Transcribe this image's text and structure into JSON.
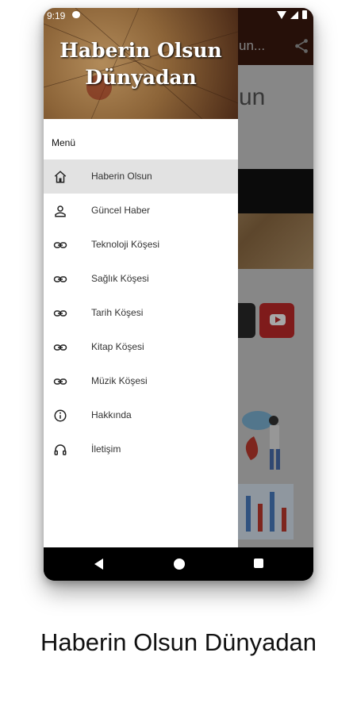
{
  "status_bar": {
    "time": "9:19"
  },
  "background_app": {
    "title": "un...",
    "heading": "un"
  },
  "drawer": {
    "header_title_line1": "Haberin Olsun",
    "header_title_line2": "Dünyadan",
    "menu_label": "Menü",
    "items": [
      {
        "label": "Haberin Olsun",
        "icon": "home-icon",
        "active": true
      },
      {
        "label": "Güncel Haber",
        "icon": "person-icon",
        "active": false
      },
      {
        "label": "Teknoloji Köşesi",
        "icon": "link-icon",
        "active": false
      },
      {
        "label": "Sağlık Köşesi",
        "icon": "link-icon",
        "active": false
      },
      {
        "label": "Tarih Köşesi",
        "icon": "link-icon",
        "active": false
      },
      {
        "label": "Kitap Köşesi",
        "icon": "link-icon",
        "active": false
      },
      {
        "label": "Müzik Köşesi",
        "icon": "link-icon",
        "active": false
      },
      {
        "label": "Hakkında",
        "icon": "info-icon",
        "active": false
      },
      {
        "label": "İletişim",
        "icon": "headset-icon",
        "active": false
      }
    ]
  },
  "caption": "Haberin Olsun Dünyadan",
  "colors": {
    "app_bar": "#3b1a0f",
    "active_item": "#e2e2e2",
    "youtube": "#c42a2a"
  }
}
